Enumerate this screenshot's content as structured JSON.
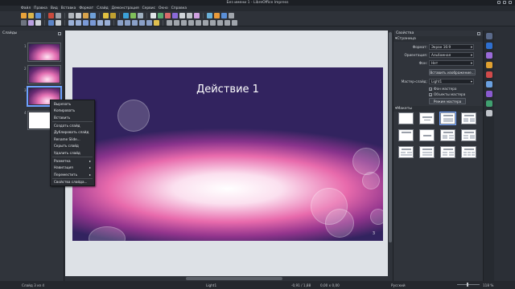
{
  "window": {
    "title": "Без имени 1 - LibreOffice Impress"
  },
  "menu": [
    "Файл",
    "Правка",
    "Вид",
    "Вставка",
    "Формат",
    "Слайд",
    "Демонстрация",
    "Сервис",
    "Окно",
    "Справка"
  ],
  "slides_panel": {
    "title": "Слайды",
    "numbers": [
      "1",
      "2",
      "3",
      "4"
    ]
  },
  "slide": {
    "title": "Действие 1",
    "number": "3"
  },
  "context_menu": {
    "items": [
      {
        "label": "Вырезать",
        "submenu": false
      },
      {
        "label": "Копировать",
        "submenu": false
      },
      {
        "label": "Вставить",
        "submenu": false
      },
      {
        "label": "Создать слайд",
        "submenu": false
      },
      {
        "label": "Дублировать слайд",
        "submenu": false
      },
      {
        "label": "Rename Slide...",
        "submenu": false
      },
      {
        "label": "Скрыть слайд",
        "submenu": false
      },
      {
        "label": "Удалить слайд",
        "submenu": false
      },
      {
        "label": "Разметка",
        "submenu": true
      },
      {
        "label": "Навигация",
        "submenu": true
      },
      {
        "label": "Переместить",
        "submenu": true
      },
      {
        "label": "Свойства слайда...",
        "submenu": false
      }
    ]
  },
  "sidebar": {
    "title": "Свойства",
    "page_section": "Страница",
    "format_label": "Формат:",
    "format_value": "Экран 16:9",
    "orientation_label": "Ориентация:",
    "orientation_value": "Альбомная",
    "background_label": "Фон:",
    "background_value": "Нет",
    "insert_image_button": "Вставить изображение...",
    "master_label": "Мастер-слайд:",
    "master_value": "Light1",
    "master_bg_checkbox": "Фон мастера",
    "master_objects_checkbox": "Объекты мастера",
    "master_mode_button": "Режим мастера",
    "layouts_section": "Макеты"
  },
  "status": {
    "slide_info": "Слайд 3 из 4",
    "master": "Light1",
    "position": "-0,91 / 1,88",
    "size": "0,00 x 0,00",
    "language": "Русский",
    "zoom": "118 %"
  }
}
